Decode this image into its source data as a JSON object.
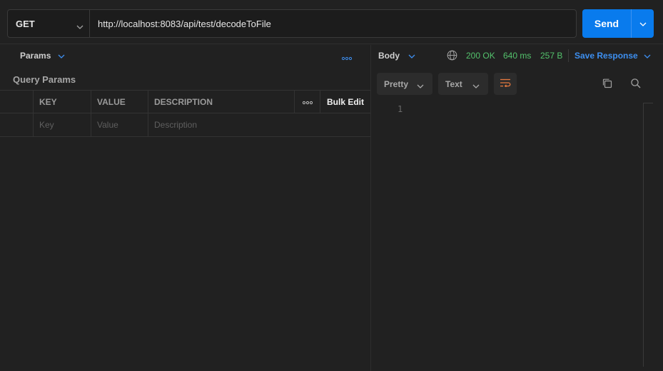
{
  "request": {
    "method": "GET",
    "url": "http://localhost:8083/api/test/decodeToFile",
    "send_label": "Send"
  },
  "params_panel": {
    "tab_label": "Params",
    "section_title": "Query Params",
    "columns": [
      "KEY",
      "VALUE",
      "DESCRIPTION"
    ],
    "bulk_edit_label": "Bulk Edit",
    "row_placeholders": {
      "key": "Key",
      "value": "Value",
      "description": "Description"
    }
  },
  "response": {
    "body_tab_label": "Body",
    "status_code": "200 OK",
    "time": "640 ms",
    "size": "257 B",
    "save_label": "Save Response",
    "format_label": "Pretty",
    "type_label": "Text",
    "line_number": "1"
  },
  "colors": {
    "background": "#212121",
    "accent": "#097bed",
    "status_ok": "#53c26c",
    "link": "#3d8ff0",
    "wrap_icon": "#e5783e"
  },
  "icons": [
    "chevron-down-icon",
    "more-horizontal-icon",
    "globe-icon",
    "wrap-lines-icon",
    "copy-icon",
    "search-icon"
  ]
}
